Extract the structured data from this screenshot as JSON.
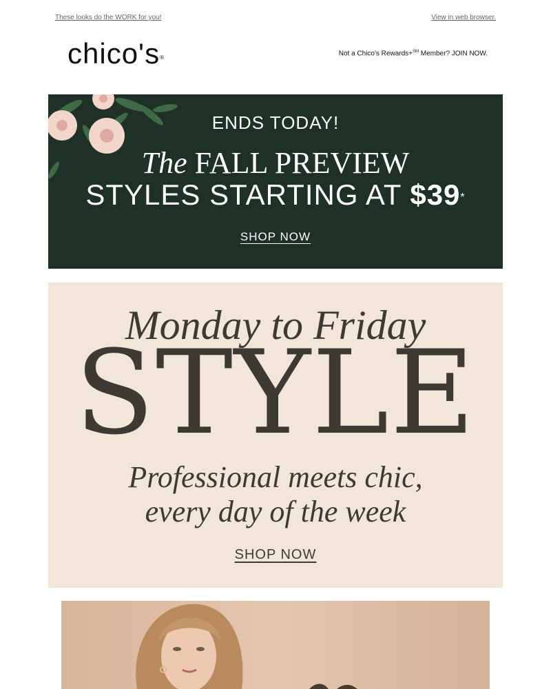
{
  "preheader": {
    "left_text": "These looks do the WORK for you!",
    "right_text": "View in web browser."
  },
  "header": {
    "logo_text": "chico's",
    "logo_mark": "®",
    "member_prefix": "Not a Chico's Rewards+",
    "member_sup": "SM",
    "member_suffix": " Member? JOIN NOW."
  },
  "banner": {
    "ends": "ENDS TODAY!",
    "title_the": "The",
    "title_rest": " FALL PREVIEW",
    "sub_prefix": "STYLES STARTING AT ",
    "sub_price": "$39",
    "sub_asterisk": "*",
    "cta": "SHOP NOW",
    "bg_color": "#1f3027"
  },
  "style_block": {
    "headline": "Monday to Friday",
    "big_word": "STYLE",
    "line1": "Professional meets chic,",
    "line2": "every day of the week",
    "cta": "SHOP NOW",
    "bg_color": "#f2e5d9",
    "text_color": "#3d3a33"
  },
  "photo": {
    "alt_icon": "model-photo"
  }
}
